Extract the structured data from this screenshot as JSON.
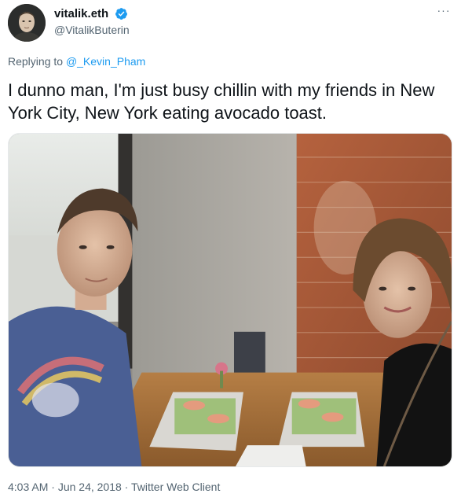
{
  "author": {
    "display_name": "vitalik.eth",
    "handle": "@VitalikButerin",
    "verified": true,
    "avatar_icon": "profile-photo"
  },
  "header": {
    "more_label": "···"
  },
  "reply": {
    "prefix": "Replying to ",
    "to_handle": "@_Kevin_Pham"
  },
  "tweet": {
    "text": "I dunno man, I'm just busy chillin with my friends in New York City, New York eating avocado toast."
  },
  "media": {
    "type": "photo"
  },
  "meta": {
    "time": "4:03 AM",
    "separator": " · ",
    "date": "Jun 24, 2018",
    "source": "Twitter Web Client"
  },
  "colors": {
    "accent": "#1d9bf0",
    "secondary_text": "#536471",
    "primary_text": "#0f1419"
  }
}
